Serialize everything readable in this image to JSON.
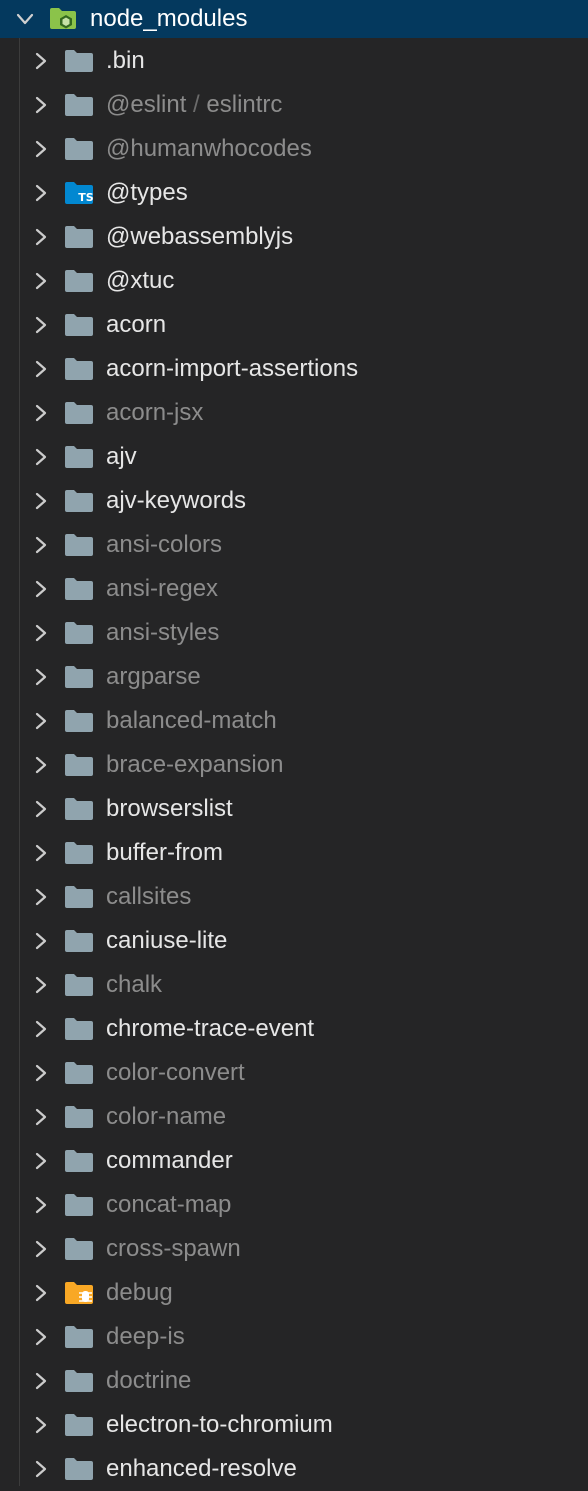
{
  "explorer": {
    "root": {
      "label": "node_modules",
      "expanded": true,
      "icon": "node-modules-folder-icon"
    },
    "items": [
      {
        "label": ".bin",
        "ignored": false,
        "icon": "folder-icon"
      },
      {
        "label": "@eslint",
        "sub": "eslintrc",
        "separator": " / ",
        "ignored": true,
        "icon": "folder-icon"
      },
      {
        "label": "@humanwhocodes",
        "ignored": true,
        "icon": "folder-icon"
      },
      {
        "label": "@types",
        "ignored": false,
        "icon": "typescript-folder-icon",
        "icon_text": "TS"
      },
      {
        "label": "@webassemblyjs",
        "ignored": false,
        "icon": "folder-icon"
      },
      {
        "label": "@xtuc",
        "ignored": false,
        "icon": "folder-icon"
      },
      {
        "label": "acorn",
        "ignored": false,
        "icon": "folder-icon"
      },
      {
        "label": "acorn-import-assertions",
        "ignored": false,
        "icon": "folder-icon"
      },
      {
        "label": "acorn-jsx",
        "ignored": true,
        "icon": "folder-icon"
      },
      {
        "label": "ajv",
        "ignored": false,
        "icon": "folder-icon"
      },
      {
        "label": "ajv-keywords",
        "ignored": false,
        "icon": "folder-icon"
      },
      {
        "label": "ansi-colors",
        "ignored": true,
        "icon": "folder-icon"
      },
      {
        "label": "ansi-regex",
        "ignored": true,
        "icon": "folder-icon"
      },
      {
        "label": "ansi-styles",
        "ignored": true,
        "icon": "folder-icon"
      },
      {
        "label": "argparse",
        "ignored": true,
        "icon": "folder-icon"
      },
      {
        "label": "balanced-match",
        "ignored": true,
        "icon": "folder-icon"
      },
      {
        "label": "brace-expansion",
        "ignored": true,
        "icon": "folder-icon"
      },
      {
        "label": "browserslist",
        "ignored": false,
        "icon": "folder-icon"
      },
      {
        "label": "buffer-from",
        "ignored": false,
        "icon": "folder-icon"
      },
      {
        "label": "callsites",
        "ignored": true,
        "icon": "folder-icon"
      },
      {
        "label": "caniuse-lite",
        "ignored": false,
        "icon": "folder-icon"
      },
      {
        "label": "chalk",
        "ignored": true,
        "icon": "folder-icon"
      },
      {
        "label": "chrome-trace-event",
        "ignored": false,
        "icon": "folder-icon"
      },
      {
        "label": "color-convert",
        "ignored": true,
        "icon": "folder-icon"
      },
      {
        "label": "color-name",
        "ignored": true,
        "icon": "folder-icon"
      },
      {
        "label": "commander",
        "ignored": false,
        "icon": "folder-icon"
      },
      {
        "label": "concat-map",
        "ignored": true,
        "icon": "folder-icon"
      },
      {
        "label": "cross-spawn",
        "ignored": true,
        "icon": "folder-icon"
      },
      {
        "label": "debug",
        "ignored": true,
        "icon": "debug-folder-icon"
      },
      {
        "label": "deep-is",
        "ignored": true,
        "icon": "folder-icon"
      },
      {
        "label": "doctrine",
        "ignored": true,
        "icon": "folder-icon"
      },
      {
        "label": "electron-to-chromium",
        "ignored": false,
        "icon": "folder-icon"
      },
      {
        "label": "enhanced-resolve",
        "ignored": false,
        "icon": "folder-icon"
      }
    ]
  },
  "colors": {
    "background": "#252526",
    "selected_row": "#04395e",
    "text_tracked": "#e6e6e6",
    "text_ignored": "#8c8c8c",
    "folder_grey": "#90a4ae",
    "folder_node_green": "#8bc34a",
    "folder_ts_blue": "#0288d1",
    "folder_debug_orange": "#f9a825"
  }
}
